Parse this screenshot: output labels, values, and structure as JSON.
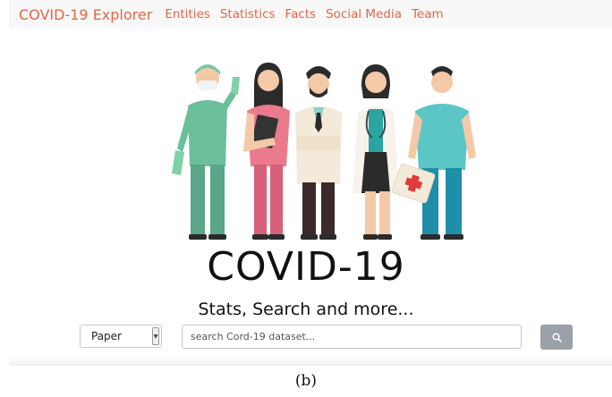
{
  "navbar": {
    "brand": "COVID-19 Explorer",
    "links": [
      "Entities",
      "Statistics",
      "Facts",
      "Social Media",
      "Team"
    ]
  },
  "hero": {
    "title": "COVID-19",
    "subtitle": "Stats, Search and more..."
  },
  "search": {
    "type_selected": "Paper",
    "placeholder": "search Cord-19 dataset...",
    "button_icon": "search-icon"
  },
  "caption": "(b)",
  "colors": {
    "brand": "#e0674a",
    "navbar_bg": "#f8f8f8",
    "search_button": "#9aa1a8"
  }
}
